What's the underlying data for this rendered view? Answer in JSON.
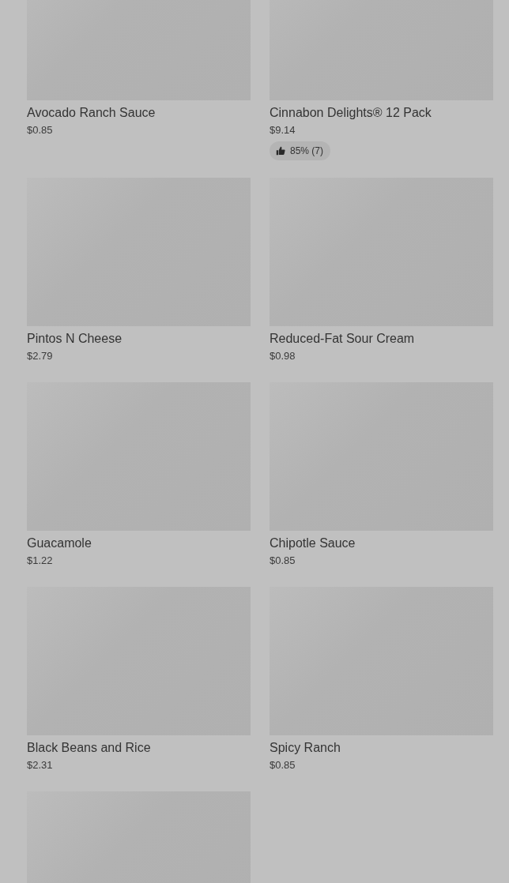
{
  "products": [
    {
      "kind": "product",
      "name": "Avocado Ranch Sauce",
      "price": "$0.85"
    },
    {
      "kind": "product",
      "name": "Cinnabon Delights® 12 Pack",
      "price": "$9.14",
      "rating": "85% (7)"
    },
    {
      "kind": "product",
      "name": "Pintos N Cheese",
      "price": "$2.79"
    },
    {
      "kind": "product",
      "name": "Reduced-Fat Sour Cream",
      "price": "$0.98"
    },
    {
      "kind": "product",
      "name": "Guacamole",
      "price": "$1.22"
    },
    {
      "kind": "product",
      "name": "Chipotle Sauce",
      "price": "$0.85"
    },
    {
      "kind": "product",
      "name": "Black Beans and Rice",
      "price": "$2.31"
    },
    {
      "kind": "product",
      "name": "Spicy Ranch",
      "price": "$0.85"
    },
    {
      "kind": "image_only"
    }
  ]
}
